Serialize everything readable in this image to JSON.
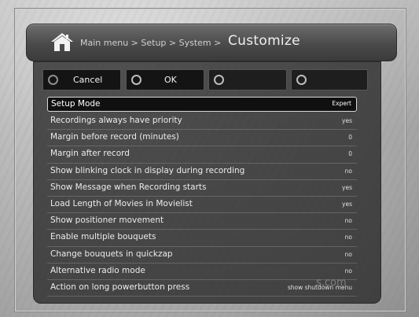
{
  "header": {
    "breadcrumb": "Main menu > Setup > System >",
    "title": "Customize"
  },
  "buttons": {
    "cancel_label": "Cancel",
    "ok_label": "OK",
    "yellow_label": "",
    "blue_label": ""
  },
  "settings": [
    {
      "label": "Setup Mode",
      "value": "Expert"
    },
    {
      "label": "Recordings always have priority",
      "value": "yes"
    },
    {
      "label": "Margin before record (minutes)",
      "value": "0"
    },
    {
      "label": "Margin after record",
      "value": "0"
    },
    {
      "label": "Show blinking clock in display during recording",
      "value": "no"
    },
    {
      "label": "Show Message when Recording starts",
      "value": "yes"
    },
    {
      "label": "Load Length of Movies in Movielist",
      "value": "yes"
    },
    {
      "label": "Show positioner movement",
      "value": "no"
    },
    {
      "label": "Enable multiple bouquets",
      "value": "no"
    },
    {
      "label": "Change bouquets in quickzap",
      "value": "no"
    },
    {
      "label": "Alternative radio mode",
      "value": "no"
    },
    {
      "label": "Action on long powerbutton press",
      "value": "show shutdown menu"
    }
  ],
  "watermark": "s.com",
  "icons": {
    "home": "home-icon",
    "button_dot": "color-button-dot-icon"
  }
}
